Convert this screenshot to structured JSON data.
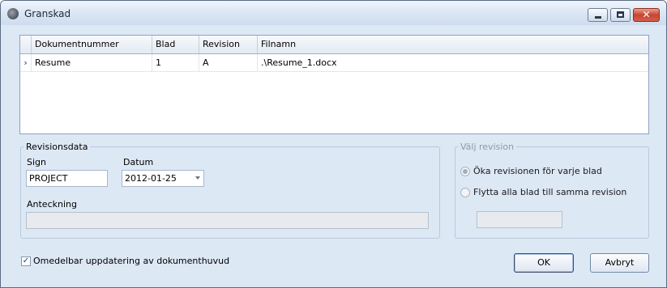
{
  "window": {
    "title": "Granskad",
    "icon": "app-globe-icon"
  },
  "grid": {
    "columns": [
      "Dokumentnummer",
      "Blad",
      "Revision",
      "Filnamn"
    ],
    "rows": [
      {
        "indicator": "›",
        "dokumentnummer": "Resume",
        "blad": "1",
        "revision": "A",
        "filnamn": ".\\Resume_1.docx"
      }
    ]
  },
  "revisionsdata": {
    "legend": "Revisionsdata",
    "sign_label": "Sign",
    "sign_value": "PROJECT",
    "datum_label": "Datum",
    "datum_value": "2012-01-25",
    "anteckning_label": "Anteckning",
    "anteckning_value": ""
  },
  "valj_revision": {
    "legend": "Välj revision",
    "option1": "Öka revisionen för varje blad",
    "option2": "Flytta alla blad till samma revision",
    "selected": "option1",
    "revision_value": ""
  },
  "footer": {
    "checkbox_label": "Omedelbar uppdatering av dokumenthuvud",
    "checkbox_checked": true,
    "checkbox_mark": "✓",
    "ok_label": "OK",
    "cancel_label": "Avbryt"
  },
  "window_controls": {
    "close_glyph": "✕"
  }
}
